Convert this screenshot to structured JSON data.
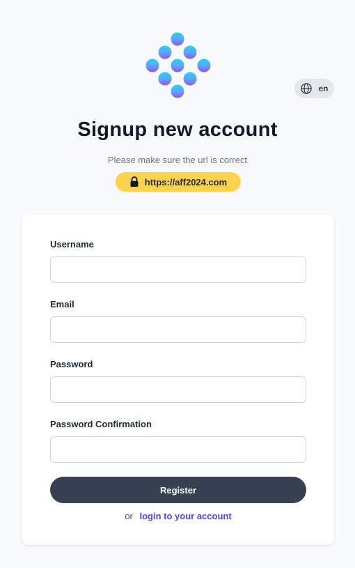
{
  "language": {
    "label": "en",
    "icon": "globe-icon"
  },
  "header": {
    "title": "Signup new account",
    "notice": "Please make sure the url is correct",
    "url": "https://aff2024.com",
    "url_icon": "lock-icon"
  },
  "form": {
    "username": {
      "label": "Username",
      "value": "",
      "placeholder": ""
    },
    "email": {
      "label": "Email",
      "value": "",
      "placeholder": ""
    },
    "password": {
      "label": "Password",
      "value": "",
      "placeholder": ""
    },
    "password_confirmation": {
      "label": "Password Confirmation",
      "value": "",
      "placeholder": ""
    },
    "register_label": "Register",
    "login_prefix": "or",
    "login_link": "login to your account"
  },
  "colors": {
    "background": "#f8f9fa",
    "button": "#374151",
    "badge": "#fcd34d",
    "link": "#4f46e5",
    "logo_gradient_top": "#22d3ee",
    "logo_gradient_bottom": "#8b5cf6"
  }
}
